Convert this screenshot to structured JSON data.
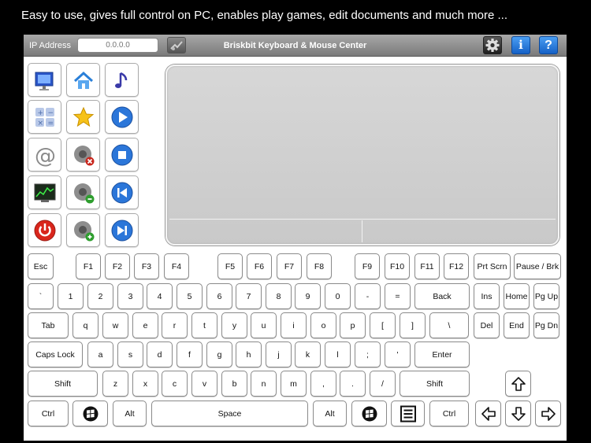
{
  "caption": "Easy to use, gives full control on PC, enables play games, edit documents and much more ...",
  "topbar": {
    "ip_label": "IP Address",
    "ip_placeholder": "0.0.0.0",
    "title": "Briskbit Keyboard & Mouse Center",
    "info_label": "i",
    "help_label": "?"
  },
  "colors": {
    "topbar": "#8f8f8f",
    "accent_blue": "#1f6fd6",
    "touchpad": "#d0d0d0",
    "power_red": "#d9261c"
  },
  "shortcuts": [
    [
      "computer-icon",
      "home-icon",
      "music-note-icon"
    ],
    [
      "calculator-icon",
      "star-icon",
      "play-icon"
    ],
    [
      "email-at-icon",
      "volume-mute-icon",
      "stop-icon"
    ],
    [
      "monitor-graph-icon",
      "volume-down-icon",
      "previous-track-icon"
    ],
    [
      "power-icon",
      "volume-up-icon",
      "next-track-icon"
    ]
  ],
  "keys": {
    "fn_row": [
      "Esc",
      "F1",
      "F2",
      "F3",
      "F4",
      "F5",
      "F6",
      "F7",
      "F8",
      "F9",
      "F10",
      "F11",
      "F12",
      "Prt Scrn",
      "Pause / Brk"
    ],
    "num_row": [
      "`",
      "1",
      "2",
      "3",
      "4",
      "5",
      "6",
      "7",
      "8",
      "9",
      "0",
      "-",
      "=",
      "Back",
      "Ins",
      "Home",
      "Pg Up"
    ],
    "tab_row": [
      "Tab",
      "q",
      "w",
      "e",
      "r",
      "t",
      "y",
      "u",
      "i",
      "o",
      "p",
      "[",
      "]",
      "\\",
      "Del",
      "End",
      "Pg Dn"
    ],
    "caps_row": [
      "Caps Lock",
      "a",
      "s",
      "d",
      "f",
      "g",
      "h",
      "j",
      "k",
      "l",
      ";",
      "'",
      "Enter"
    ],
    "shift_row": [
      "Shift",
      "z",
      "x",
      "c",
      "v",
      "b",
      "n",
      "m",
      ",",
      ".",
      "/",
      "Shift"
    ],
    "bottom_row": [
      "Ctrl",
      "Alt",
      "Space",
      "Alt",
      "Ctrl"
    ],
    "arrows": [
      "up-arrow-icon",
      "left-arrow-icon",
      "down-arrow-icon",
      "right-arrow-icon"
    ],
    "windows_icon": "windows-logo-icon",
    "menu_icon": "context-menu-icon"
  }
}
